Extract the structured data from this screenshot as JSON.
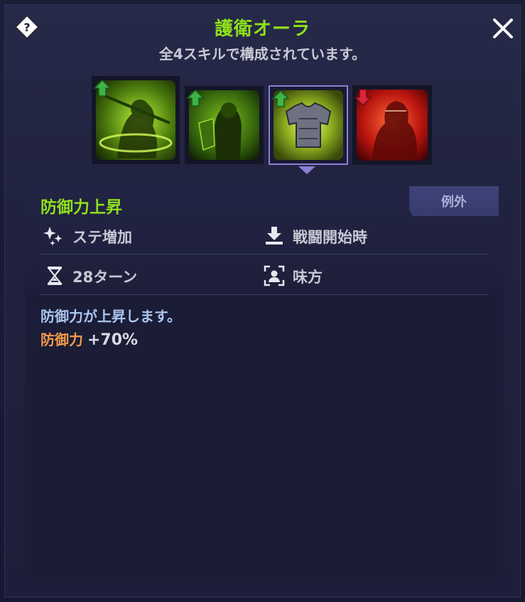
{
  "header": {
    "title": "護衛オーラ",
    "subtitle": "全4スキルで構成されています。"
  },
  "skills": [
    {
      "name": "skill-archer",
      "buff": "up",
      "selected": false
    },
    {
      "name": "skill-shield-knight",
      "buff": "up",
      "selected": false
    },
    {
      "name": "skill-armor",
      "buff": "up",
      "selected": true
    },
    {
      "name": "skill-red-warrior",
      "buff": "down",
      "selected": false
    }
  ],
  "effect": {
    "title": "防御力上昇",
    "badge": "例外",
    "type_label": "ステ増加",
    "timing_label": "戦闘開始時",
    "duration_label": "28ターン",
    "target_label": "味方",
    "description": "防御力が上昇します。",
    "stat_name": "防御力",
    "stat_value": "+70%"
  },
  "colors": {
    "title_green": "#8fe01a",
    "stat_orange": "#f39a4a",
    "desc_blue": "#aac6ef",
    "selected_border": "#8b7fd6",
    "buff_up": "#3db446",
    "buff_down": "#d9263a"
  },
  "icons": {
    "help": "help-diamond-icon",
    "close": "close-icon",
    "type": "sparkle-icon",
    "timing": "download-tray-icon",
    "duration": "hourglass-icon",
    "target": "person-frame-icon"
  }
}
